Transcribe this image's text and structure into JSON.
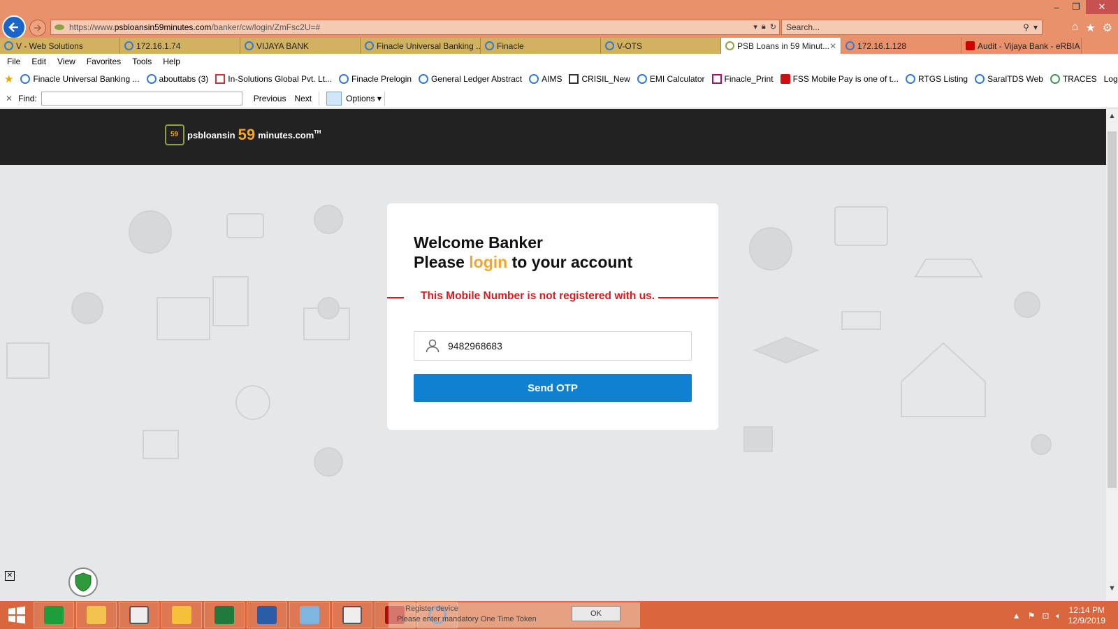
{
  "browser": {
    "url_prefix": "https://www.",
    "url_domain": "psbloansin59minutes.com",
    "url_path": "/banker/cw/login/ZmFsc2U=#",
    "search_placeholder": "Search...",
    "tabs": [
      {
        "label": "V - Web Solutions"
      },
      {
        "label": "172.16.1.74"
      },
      {
        "label": "VIJAYA BANK"
      },
      {
        "label": "Finacle Universal Banking ..."
      },
      {
        "label": "Finacle"
      },
      {
        "label": "V-OTS"
      },
      {
        "label": "PSB Loans in 59 Minut..."
      },
      {
        "label": "172.16.1.128"
      },
      {
        "label": "Audit - Vijaya Bank - eRBIA"
      }
    ],
    "menu": [
      "File",
      "Edit",
      "View",
      "Favorites",
      "Tools",
      "Help"
    ],
    "favorites": [
      "Finacle Universal Banking ...",
      "abouttabs (3)",
      "In-Solutions Global Pvt. Lt...",
      "Finacle Prelogin",
      "General Ledger Abstract",
      "AIMS",
      "CRISIL_New",
      "EMI Calculator",
      "Finacle_Print",
      "FSS Mobile Pay is one of t...",
      "RTGS Listing",
      "SaralTDS Web",
      "TRACES",
      "Login"
    ],
    "find": {
      "label": "Find:",
      "value": "",
      "previous": "Previous",
      "next": "Next",
      "options": "Options"
    }
  },
  "site": {
    "logo_part1": "psbloansin",
    "logo_part2": "59",
    "logo_part3": "minutes.com",
    "logo_tm": "TM",
    "logo_badge": "59"
  },
  "login": {
    "line1": "Welcome Banker",
    "line2_pre": "Please ",
    "line2_highlight": "login",
    "line2_post": " to your account",
    "error": "This Mobile Number is not registered with us.",
    "mobile_value": "9482968683",
    "send_otp": "Send OTP"
  },
  "taskbar": {
    "popup_line1": "Register device",
    "popup_line2": "Please enter mandatory One Time Token",
    "popup_ok": "OK",
    "time": "12:14 PM",
    "date": "12/9/2019"
  },
  "colors": {
    "accent_orange": "#f5a623",
    "error_red": "#e0191e",
    "button_blue": "#1080d0",
    "header_dark": "#222222",
    "chrome_orange": "#e9916a"
  }
}
